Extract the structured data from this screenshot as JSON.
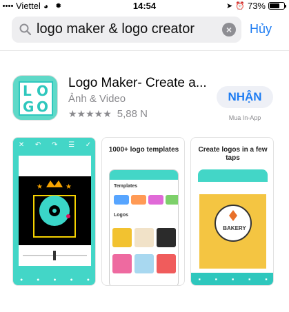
{
  "status_bar": {
    "carrier": "Viettel",
    "time": "14:54",
    "battery_percent": "73%"
  },
  "search": {
    "query": "logo maker & logo creator",
    "cancel_label": "Hủy"
  },
  "app": {
    "title": "Logo Maker- Create a...",
    "category": "Ảnh & Video",
    "stars": "★★★★★",
    "rating_count": "5,88 N",
    "get_label": "NHẬN",
    "iap_note": "Mua In-App"
  },
  "screenshots": {
    "shot2_heading": "1000+ logo templates",
    "shot2_section1": "Templates",
    "shot2_section2": "Logos",
    "shot3_heading": "Create logos in a few taps",
    "shot3_logo_text": "BAKERY"
  },
  "colors": {
    "accent": "#1d7cf2",
    "teal": "#43d6c7",
    "gray_text": "#8a8a8e"
  }
}
